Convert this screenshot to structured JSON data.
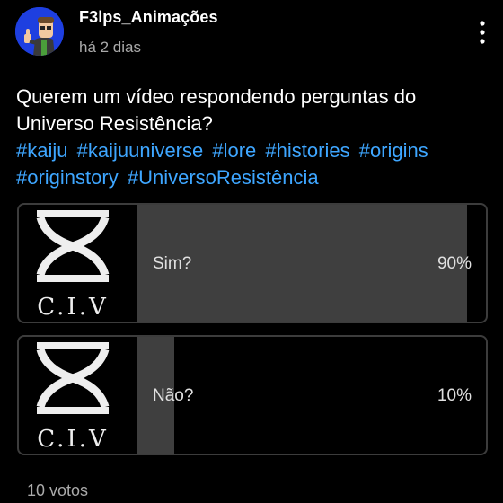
{
  "header": {
    "author": "F3lps_Animações",
    "time": "há 2 dias",
    "menu_icon": "more-vertical-icon"
  },
  "post": {
    "text": "Querem um vídeo respondendo perguntas do Universo Resistência?",
    "hashtags": [
      "#kaiju",
      "#kaijuuniverse",
      "#lore",
      "#histories",
      "#origins",
      "#originstory",
      "#UniversoResistência"
    ]
  },
  "poll": {
    "image_caption": "C.I.V",
    "options": [
      {
        "label": "Sim?",
        "percent_text": "90%",
        "fraction": 0.9
      },
      {
        "label": "Não?",
        "percent_text": "10%",
        "fraction": 0.1
      }
    ],
    "votes": "10 votos"
  },
  "colors": {
    "background": "#000000",
    "hashtag": "#3ea6ff",
    "poll_fill": "#3f3f3f",
    "avatar_bg": "#1e3fe0"
  }
}
